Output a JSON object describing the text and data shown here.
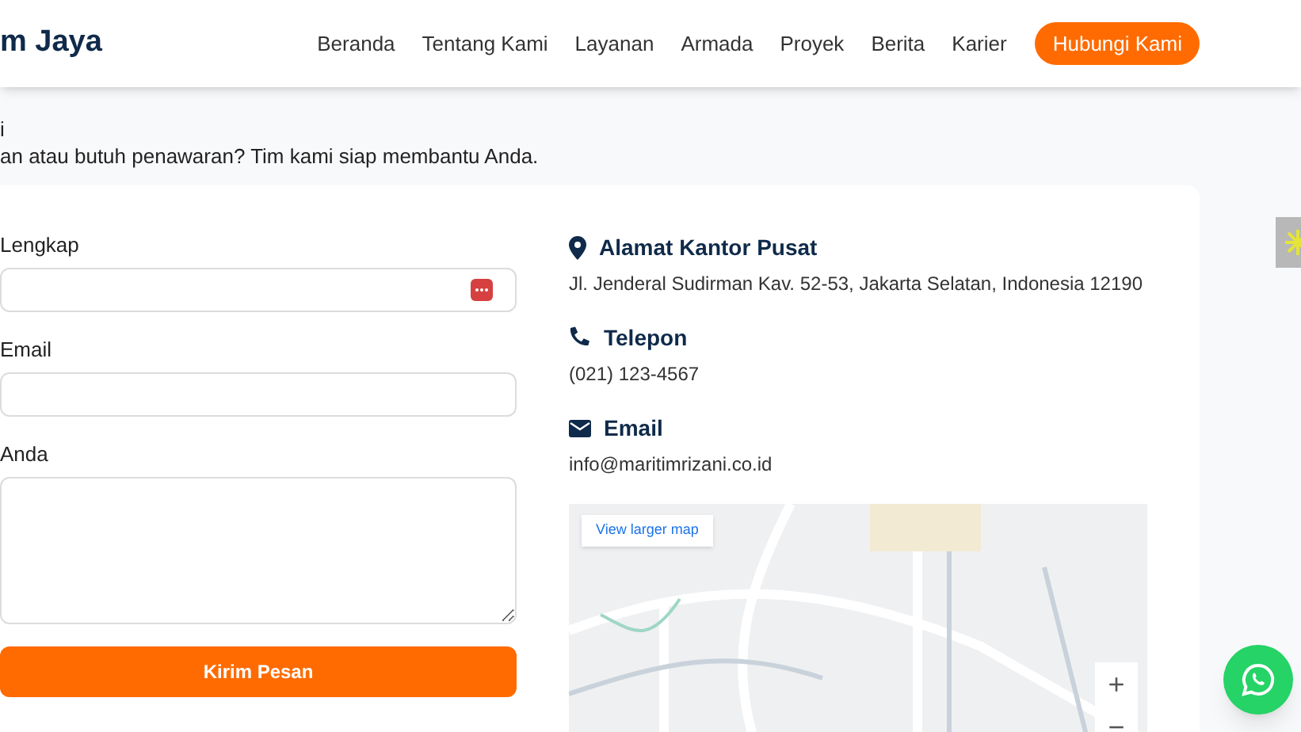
{
  "header": {
    "logo": "m Jaya",
    "nav": [
      {
        "label": "Beranda"
      },
      {
        "label": "Tentang Kami"
      },
      {
        "label": "Layanan"
      },
      {
        "label": "Armada"
      },
      {
        "label": "Proyek"
      },
      {
        "label": "Berita"
      },
      {
        "label": "Karier"
      }
    ],
    "cta": "Hubungi Kami"
  },
  "intro": {
    "title": "i",
    "subtitle": "an atau butuh penawaran? Tim kami siap membantu Anda."
  },
  "form": {
    "fields": [
      {
        "label": "Lengkap",
        "kind": "input"
      },
      {
        "label": "Email",
        "kind": "input"
      },
      {
        "label": "Anda",
        "kind": "textarea"
      }
    ],
    "submit": "Kirim Pesan"
  },
  "contact": [
    {
      "kind": "pin",
      "title": "Alamat Kantor Pusat",
      "value": "Jl. Jenderal Sudirman Kav. 52-53, Jakarta Selatan, Indonesia 12190"
    },
    {
      "kind": "phone",
      "title": "Telepon",
      "value": "(021) 123-4567"
    },
    {
      "kind": "mail",
      "title": "Email",
      "value": "info@maritimrizani.co.id"
    }
  ],
  "map": {
    "link": "View larger map",
    "zoom_in": "+",
    "zoom_out": "−"
  }
}
